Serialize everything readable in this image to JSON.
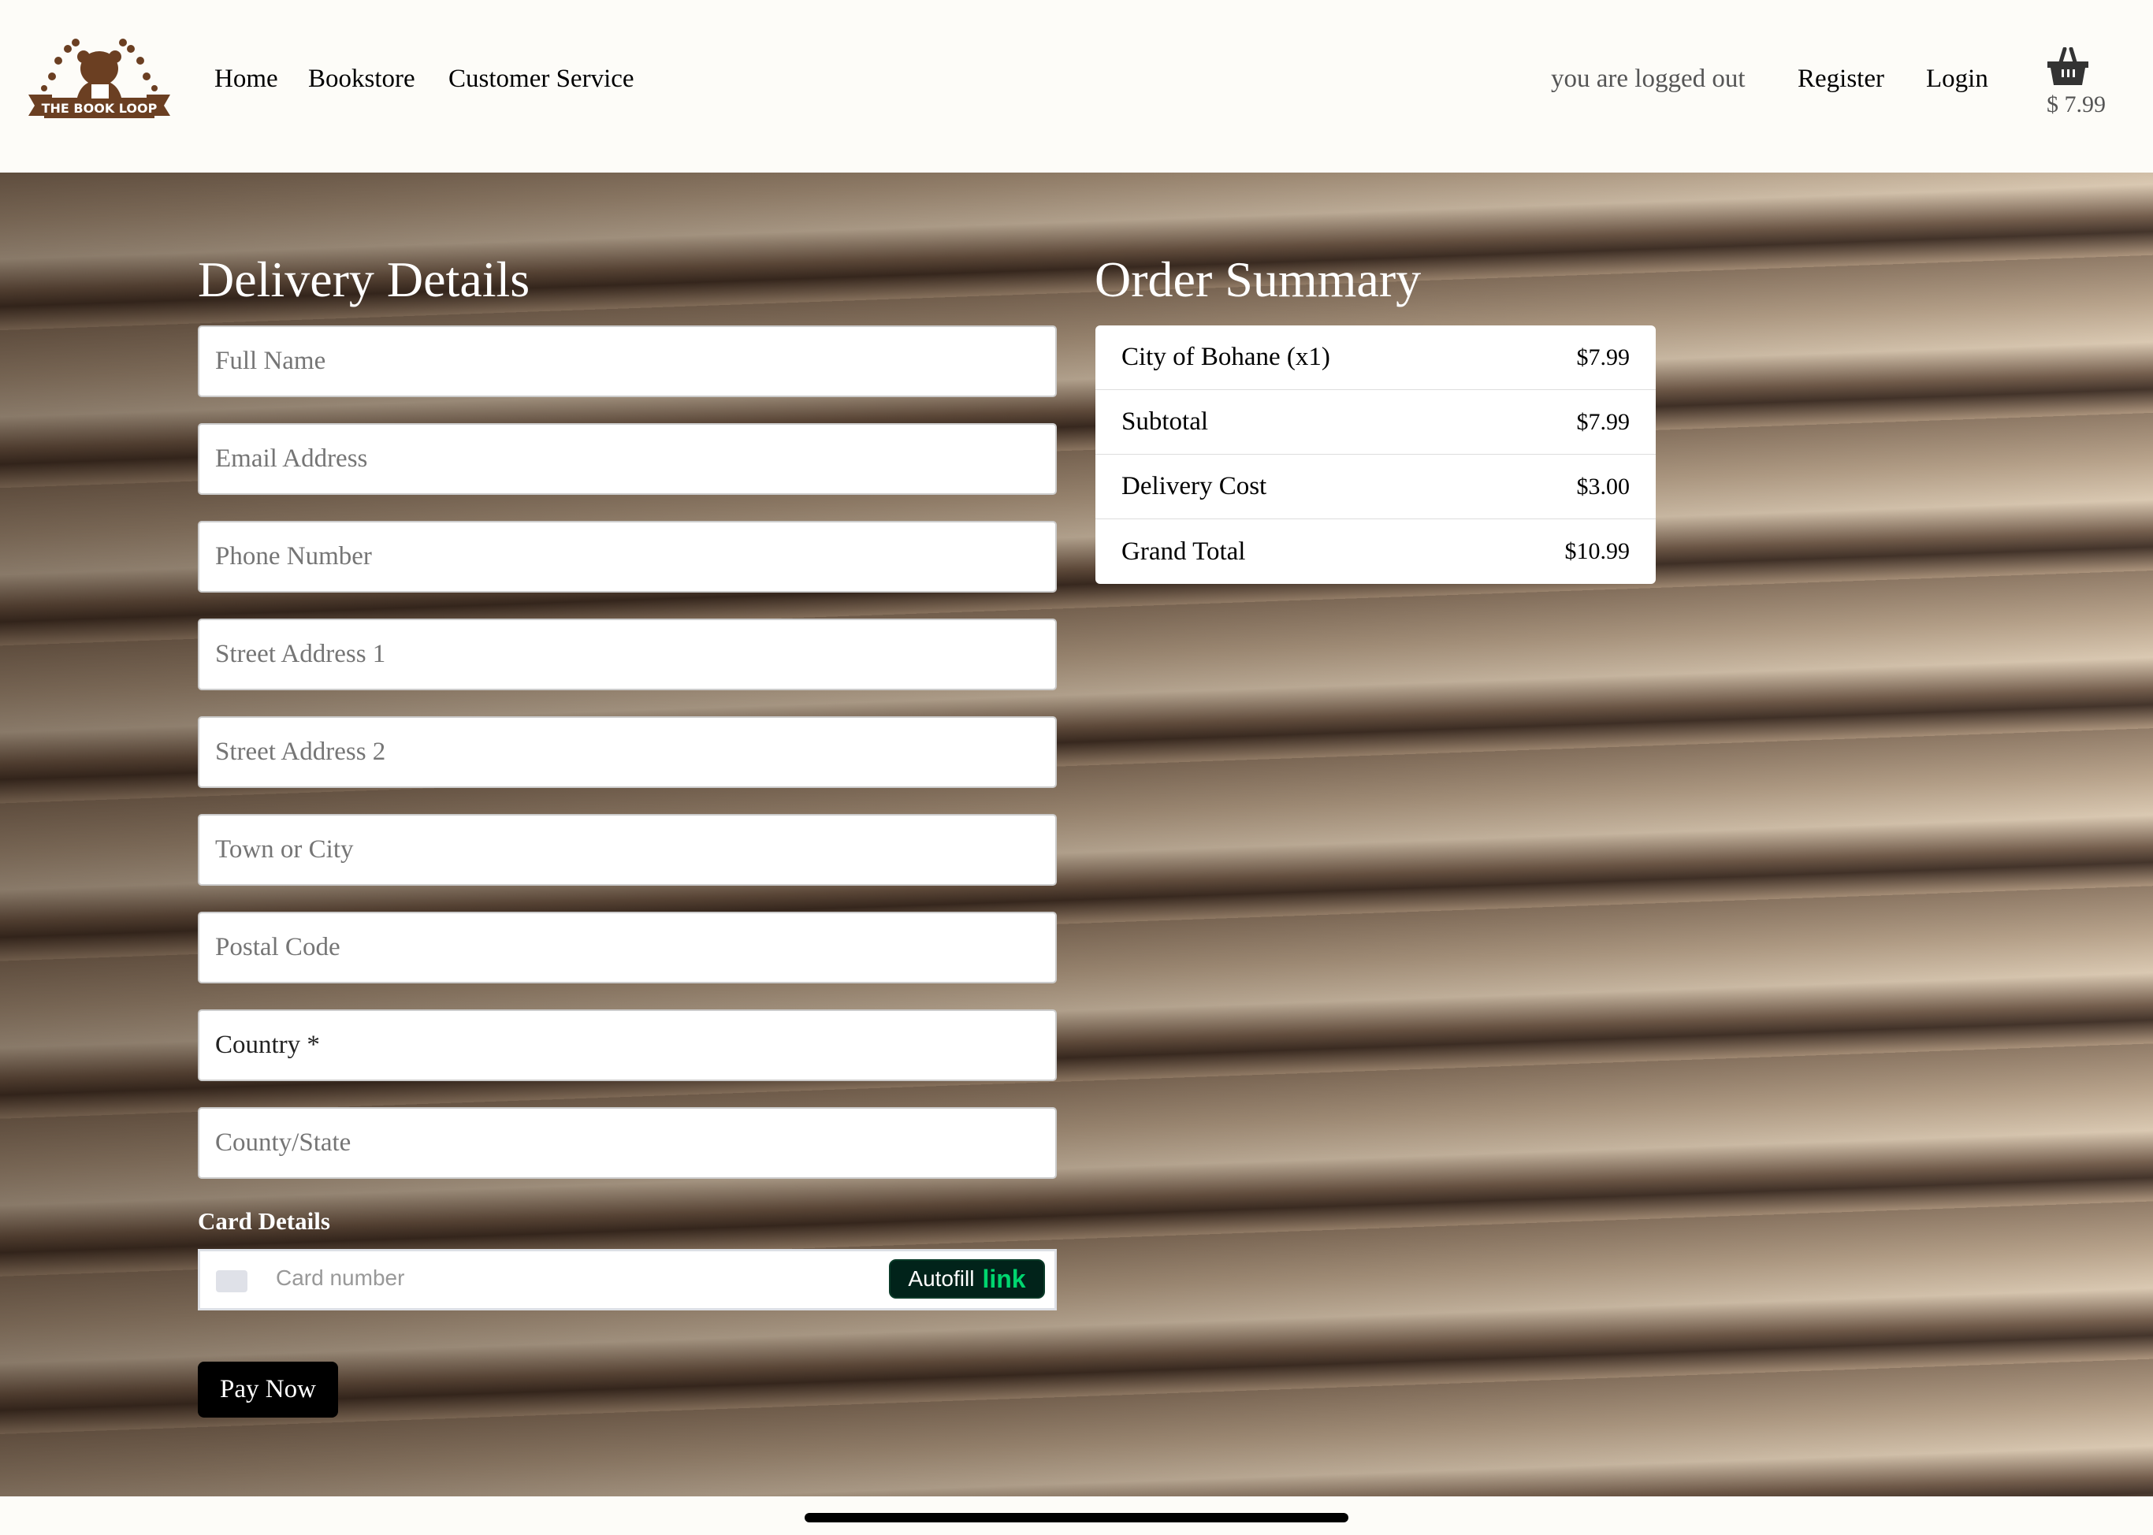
{
  "header": {
    "logo_text": "THE BOOK LOOP",
    "nav": [
      "Home",
      "Bookstore",
      "Customer Service"
    ],
    "status": "you are logged out",
    "register": "Register",
    "login": "Login",
    "cart_total": "$ 7.99",
    "brand_color": "#6b3f22"
  },
  "delivery": {
    "title": "Delivery Details",
    "fields": [
      "Full Name",
      "Email Address",
      "Phone Number",
      "Street Address 1",
      "Street Address 2",
      "Town or City",
      "Postal Code",
      "Country *",
      "County/State"
    ]
  },
  "summary": {
    "title": "Order Summary",
    "rows": [
      {
        "label": "City of Bohane (x1)",
        "value": "$7.99"
      },
      {
        "label": "Subtotal",
        "value": "$7.99"
      },
      {
        "label": "Delivery Cost",
        "value": "$3.00"
      },
      {
        "label": "Grand Total",
        "value": "$10.99"
      }
    ]
  },
  "card": {
    "label": "Card Details",
    "placeholder": "Card number",
    "autofill": "Autofill",
    "link": "link"
  },
  "pay_label": "Pay Now"
}
